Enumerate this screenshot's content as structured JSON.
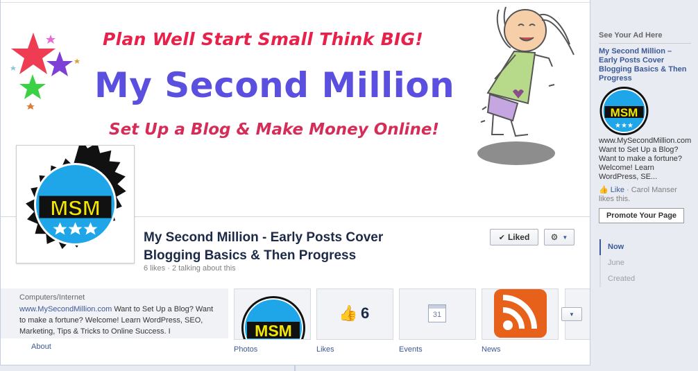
{
  "cover": {
    "tagline": "Plan Well Start Small Think BIG!",
    "brand": "My Second Million",
    "subtag": "Set Up a Blog & Make Money Online!"
  },
  "profile": {
    "logo_text": "MSM",
    "name": "My Second Million - Early Posts Cover Blogging Basics & Then Progress",
    "stats": "6 likes · 2 talking about this"
  },
  "actions": {
    "liked_label": "Liked"
  },
  "about": {
    "category": "Computers/Internet",
    "url": "www.MySecondMillion.com",
    "description": " Want to Set Up a Blog? Want to make a fortune? Welcome! Learn WordPress, SEO, Marketing, Tips & Tricks to Online Success. I",
    "link_label": "About"
  },
  "apps": {
    "photos_label": "Photos",
    "likes_label": "Likes",
    "likes_count": "6",
    "events_label": "Events",
    "events_day": "31",
    "news_label": "News"
  },
  "sidebar": {
    "ad_header": "See Your Ad Here",
    "ad_title": "My Second Million – Early Posts Cover Blogging Basics & Then Progress",
    "ad_logo_text": "MSM",
    "ad_body": "www.MySecondMillion.com Want to Set Up a Blog? Want to make a fortune? Welcome! Learn WordPress, SE...",
    "ad_like_label": "Like",
    "ad_like_text": " · Carol Manser likes this.",
    "promote_label": "Promote Your Page",
    "timeline": [
      "Now",
      "June",
      "Created"
    ]
  },
  "colors": {
    "fb_blue": "#3b5998",
    "tagline_red": "#e8204a",
    "brand_purple": "#5b4fe0",
    "badge_cyan": "#1ea6e8",
    "badge_yellow": "#f3e600"
  }
}
